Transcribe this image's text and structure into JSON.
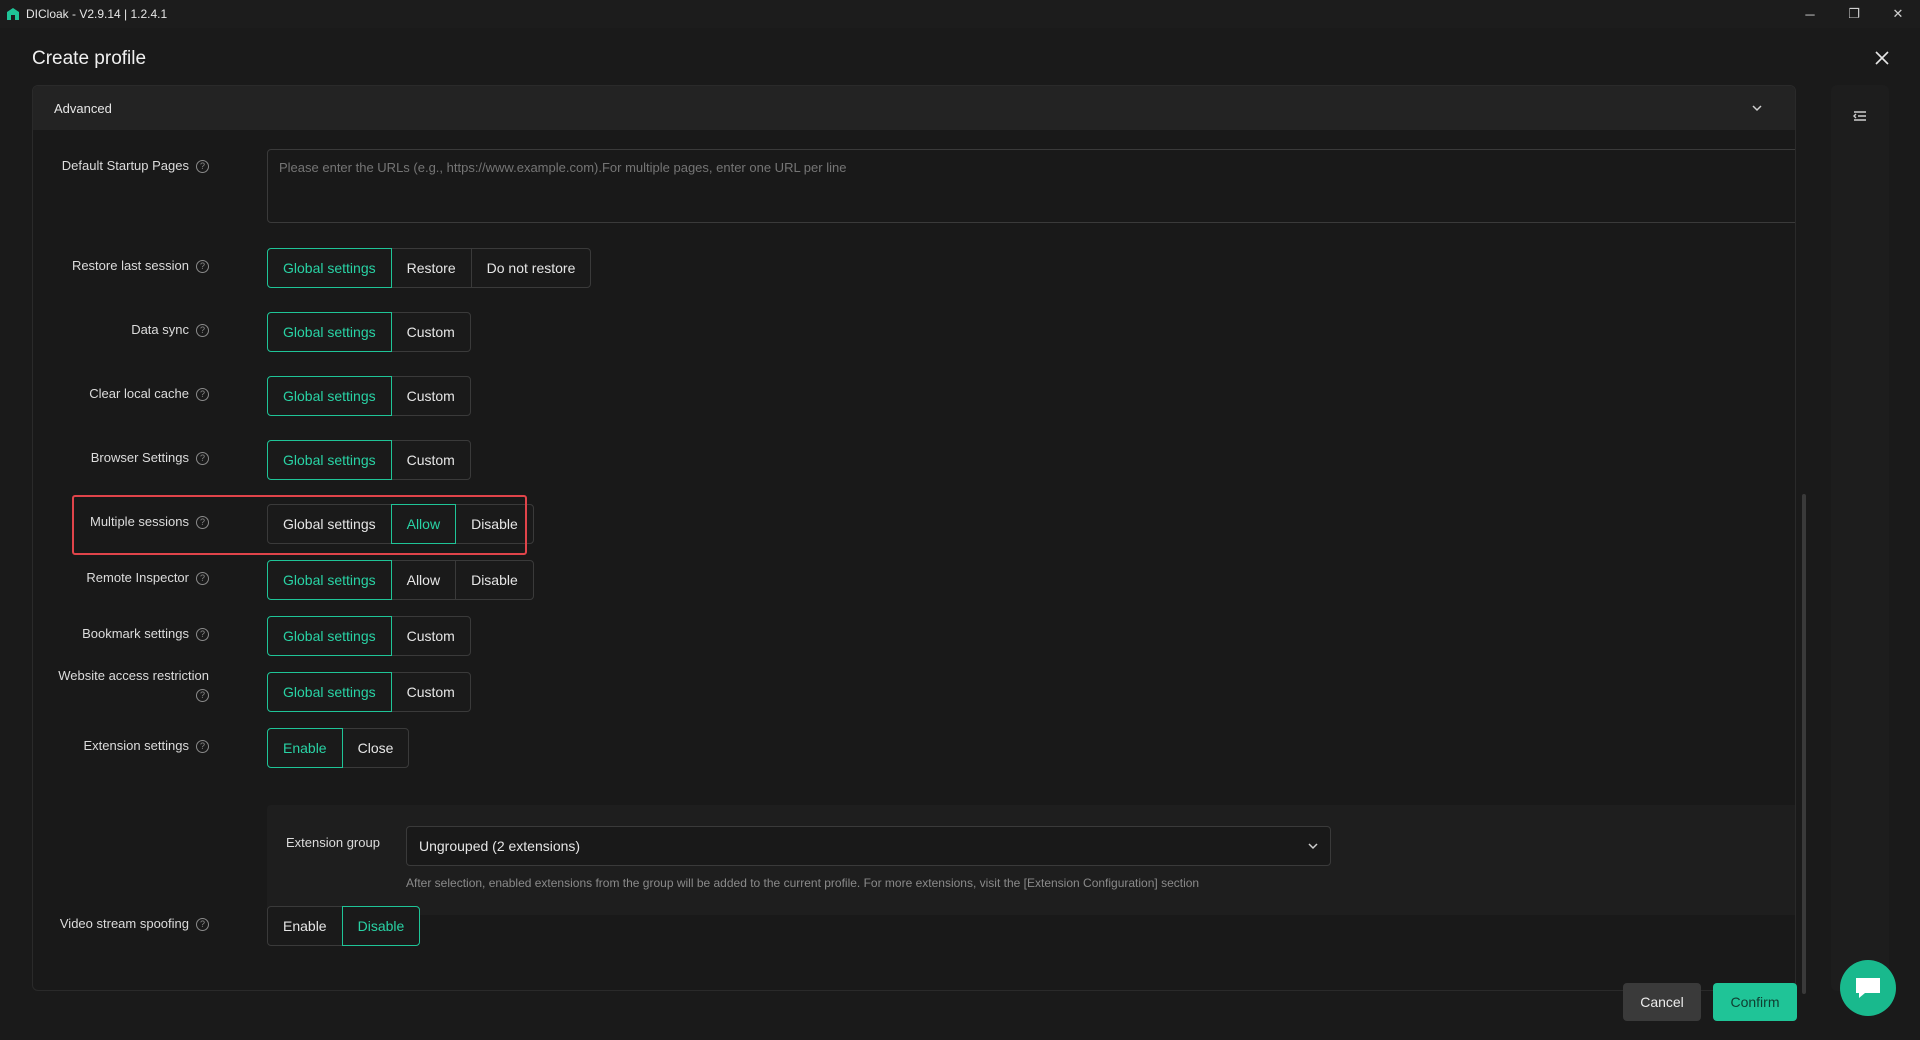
{
  "window": {
    "title": "DICloak - V2.9.14 | 1.2.4.1",
    "controls": {
      "minimize": "─",
      "maximize": "❐",
      "close": "✕"
    }
  },
  "dialog": {
    "title": "Create profile",
    "section_title": "Advanced",
    "default_startup_pages": {
      "label": "Default Startup Pages",
      "placeholder": "Please enter the URLs (e.g., https://www.example.com).For multiple pages, enter one URL per line"
    },
    "settings": [
      {
        "label": "Restore last session",
        "options": [
          "Global settings",
          "Restore",
          "Do not restore"
        ],
        "selected": "Global settings"
      },
      {
        "label": "Data sync",
        "options": [
          "Global settings",
          "Custom"
        ],
        "selected": "Global settings"
      },
      {
        "label": "Clear local cache",
        "options": [
          "Global settings",
          "Custom"
        ],
        "selected": "Global settings"
      },
      {
        "label": "Browser Settings",
        "options": [
          "Global settings",
          "Custom"
        ],
        "selected": "Global settings"
      },
      {
        "label": "Multiple sessions",
        "options": [
          "Global settings",
          "Allow",
          "Disable"
        ],
        "selected": "Allow"
      },
      {
        "label": "Remote Inspector",
        "options": [
          "Global settings",
          "Allow",
          "Disable"
        ],
        "selected": "Global settings"
      },
      {
        "label": "Bookmark settings",
        "options": [
          "Global settings",
          "Custom"
        ],
        "selected": "Global settings"
      },
      {
        "label": "Website access restriction",
        "options": [
          "Global settings",
          "Custom"
        ],
        "selected": "Global settings"
      },
      {
        "label": "Extension settings",
        "options": [
          "Enable",
          "Close"
        ],
        "selected": "Enable"
      },
      {
        "label": "Video stream spoofing",
        "options": [
          "Enable",
          "Disable"
        ],
        "selected": "Disable"
      }
    ],
    "extension_group": {
      "label": "Extension group",
      "value": "Ungrouped (2 extensions)",
      "hint": "After selection, enabled extensions from the group will be added to the current profile. For more extensions, visit the [Extension Configuration] section"
    },
    "buttons": {
      "cancel": "Cancel",
      "confirm": "Confirm"
    },
    "help_glyph": "?"
  },
  "colors": {
    "accent": "#1fc497",
    "highlight": "#e0444a",
    "background": "#1a1a1a"
  }
}
